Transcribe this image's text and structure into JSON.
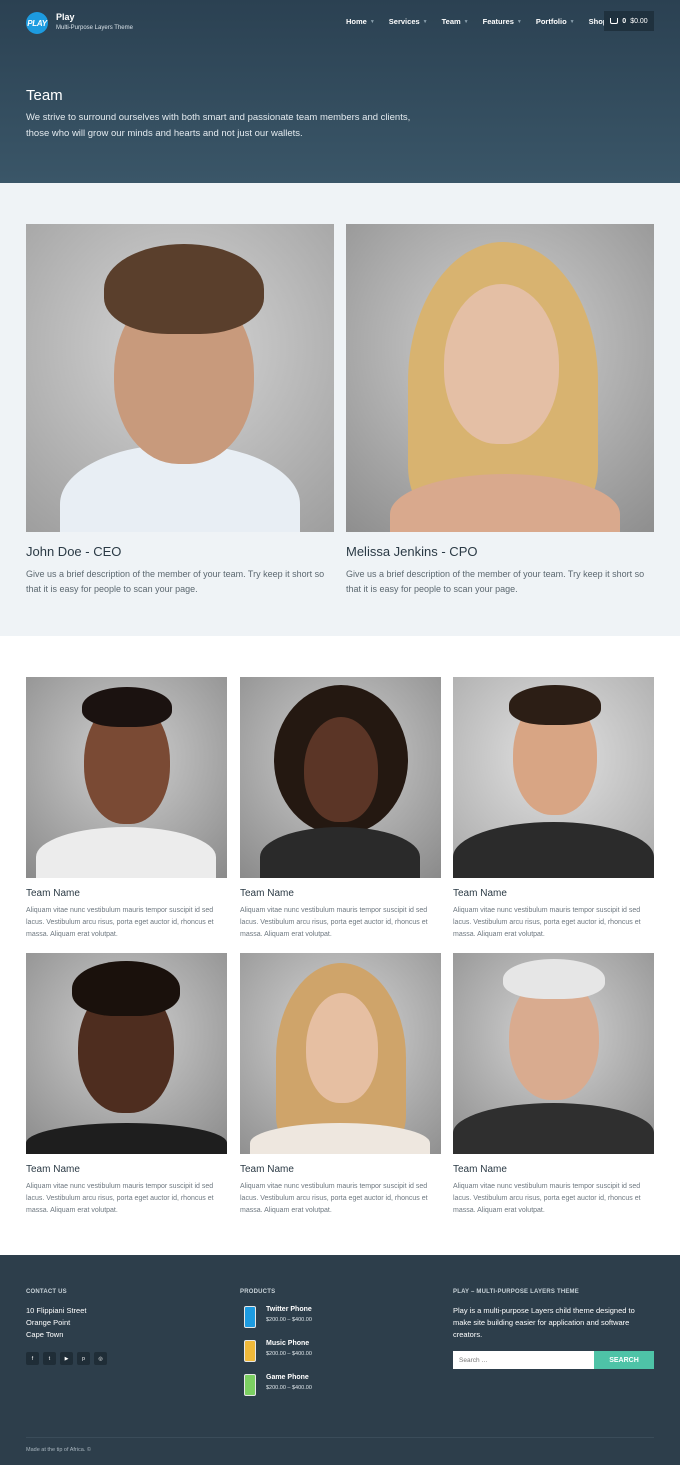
{
  "brand": {
    "logo": "PLAY",
    "title": "Play",
    "subtitle": "Multi-Purpose Layers Theme"
  },
  "nav": {
    "items": [
      "Home",
      "Services",
      "Team",
      "Features",
      "Portfolio",
      "Shop"
    ]
  },
  "cart": {
    "count": "0",
    "total": "$0.00"
  },
  "hero": {
    "title": "Team",
    "text": "We strive to surround ourselves with both smart and passionate team members and clients, those who will grow our minds and hearts and not just our wallets."
  },
  "leaders": [
    {
      "name": "John Doe - CEO",
      "desc": "Give us a brief description of the member of your team. Try keep it short so that it is easy for people to scan your page."
    },
    {
      "name": "Melissa Jenkins - CPO",
      "desc": "Give us a brief description of the member of your team. Try keep it short so that it is easy for people to scan your page."
    }
  ],
  "team": [
    {
      "name": "Team Name",
      "desc": "Aliquam vitae nunc vestibulum mauris tempor suscipit id sed lacus. Vestibulum arcu risus, porta eget auctor id, rhoncus et massa. Aliquam erat volutpat."
    },
    {
      "name": "Team Name",
      "desc": "Aliquam vitae nunc vestibulum mauris tempor suscipit id sed lacus. Vestibulum arcu risus, porta eget auctor id, rhoncus et massa. Aliquam erat volutpat."
    },
    {
      "name": "Team Name",
      "desc": "Aliquam vitae nunc vestibulum mauris tempor suscipit id sed lacus. Vestibulum arcu risus, porta eget auctor id, rhoncus et massa. Aliquam erat volutpat."
    },
    {
      "name": "Team Name",
      "desc": "Aliquam vitae nunc vestibulum mauris tempor suscipit id sed lacus. Vestibulum arcu risus, porta eget auctor id, rhoncus et massa. Aliquam erat volutpat."
    },
    {
      "name": "Team Name",
      "desc": "Aliquam vitae nunc vestibulum mauris tempor suscipit id sed lacus. Vestibulum arcu risus, porta eget auctor id, rhoncus et massa. Aliquam erat volutpat."
    },
    {
      "name": "Team Name",
      "desc": "Aliquam vitae nunc vestibulum mauris tempor suscipit id sed lacus. Vestibulum arcu risus, porta eget auctor id, rhoncus et massa. Aliquam erat volutpat."
    }
  ],
  "footer": {
    "contact_heading": "CONTACT US",
    "address": [
      "10 Flippiani Street",
      "Orange Point",
      "Cape Town"
    ],
    "socials": [
      "facebook-icon",
      "twitter-icon",
      "youtube-icon",
      "pinterest-icon",
      "dribbble-icon"
    ],
    "products_heading": "PRODUCTS",
    "products": [
      {
        "name": "Twitter Phone",
        "price": "$200.00 – $400.00",
        "color": "#1d9be0"
      },
      {
        "name": "Music Phone",
        "price": "$200.00 – $400.00",
        "color": "#f0b93a"
      },
      {
        "name": "Game Phone",
        "price": "$200.00 – $400.00",
        "color": "#7ccf62"
      }
    ],
    "about_heading": "PLAY – MULTI-PURPOSE LAYERS THEME",
    "about_text": "Play is a multi-purpose Layers child theme designed to make site building easier for application and software creators.",
    "search_placeholder": "Search …",
    "search_button": "SEARCH",
    "copyright": "Made at the tip of Africa. ©"
  }
}
